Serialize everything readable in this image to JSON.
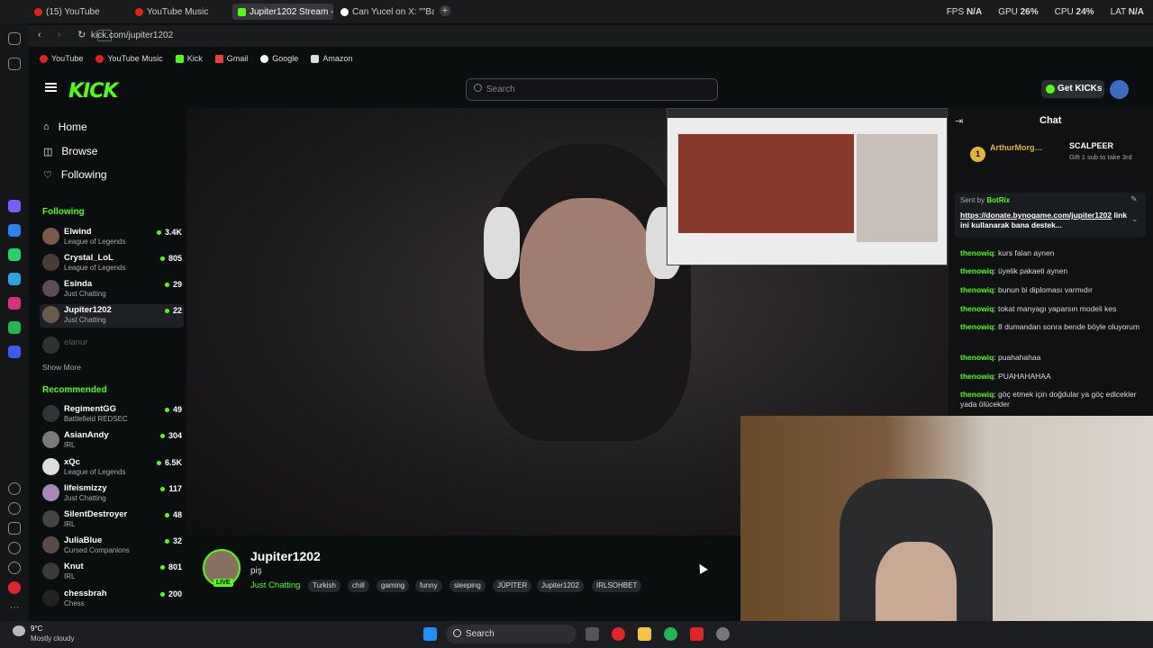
{
  "browser": {
    "tabs": [
      {
        "label": "(15) YouTube",
        "color": "#e62117"
      },
      {
        "label": "YouTube Music",
        "color": "#e62117"
      },
      {
        "label": "Jupiter1202 Stream - …",
        "color": "#53fc18"
      },
      {
        "label": "Can Yucel on X: \"\"Bana g…",
        "color": "#ffffff"
      }
    ],
    "hud": {
      "fps_label": "FPS",
      "fps": "N/A",
      "gpu_label": "GPU",
      "gpu": "26%",
      "cpu_label": "CPU",
      "cpu": "24%",
      "lat_label": "LAT",
      "lat": "N/A"
    },
    "url": "kick.com/jupiter1202",
    "bookmarks": [
      "YouTube",
      "YouTube Music",
      "Kick",
      "Gmail",
      "Google",
      "Amazon"
    ]
  },
  "header": {
    "logo": "KICK",
    "search_placeholder": "Search",
    "get_kicks": "Get KICKs"
  },
  "nav": {
    "home": "Home",
    "browse": "Browse",
    "following": "Following"
  },
  "following": {
    "title": "Following",
    "show_more": "Show More",
    "channels": [
      {
        "name": "Elwind",
        "category": "League of Legends",
        "viewers": "3.4K"
      },
      {
        "name": "Crystal_LoL",
        "category": "League of Legends",
        "viewers": "805"
      },
      {
        "name": "Esinda",
        "category": "Just Chatting",
        "viewers": "29"
      },
      {
        "name": "Jupiter1202",
        "category": "Just Chatting",
        "viewers": "22"
      },
      {
        "name": "elanur",
        "category": "",
        "viewers": ""
      }
    ]
  },
  "recommended": {
    "title": "Recommended",
    "channels": [
      {
        "name": "RegimentGG",
        "category": "Battlefield REDSEC",
        "viewers": "49"
      },
      {
        "name": "AsianAndy",
        "category": "IRL",
        "viewers": "304"
      },
      {
        "name": "xQc",
        "category": "League of Legends",
        "viewers": "6.5K"
      },
      {
        "name": "lifeismizzy",
        "category": "Just Chatting",
        "viewers": "117"
      },
      {
        "name": "SilentDestroyer",
        "category": "IRL",
        "viewers": "48"
      },
      {
        "name": "JuliaBlue",
        "category": "Cursed Companions",
        "viewers": "32"
      },
      {
        "name": "Knut",
        "category": "IRL",
        "viewers": "801"
      },
      {
        "name": "chessbrah",
        "category": "Chess",
        "viewers": "200"
      }
    ]
  },
  "chat": {
    "title": "Chat",
    "gifter_name": "ArthurMorg…",
    "gifter_badge": "1",
    "gift_user": "SCALPEER",
    "gift_text": "Gift 1 sub to take 3rd",
    "pinned_by_label": "Sent by",
    "pinned_by": "BotRix",
    "pinned_link": "https://donate.bynogame.com/jupiter1202",
    "pinned_text": "linkini kullanarak bana destek...",
    "messages": [
      {
        "user": "thenowiq",
        "text": "kurs falan aynen"
      },
      {
        "user": "thenowiq",
        "text": "üyelik pakaeti aynen"
      },
      {
        "user": "thenowiq",
        "text": "bunun bi diploması varmıdır"
      },
      {
        "user": "thenowiq",
        "text": "tokat manyagı yaparsın modeli kes"
      },
      {
        "user": "thenowiq",
        "text": "8 dumandan sonra bende böyle oluyorum"
      },
      {
        "user": "thenowiq",
        "text": "puahahahaa"
      },
      {
        "user": "thenowiq",
        "text": "PUAHAHAHAA"
      },
      {
        "user": "thenowiq",
        "text": "göç etmek için doğdular ya göç edicekler yada ölücekler"
      }
    ]
  },
  "stream": {
    "streamer": "Jupiter1202",
    "title": "piş",
    "live": "LIVE",
    "category": "Just Chatting",
    "tags": [
      "Turkish",
      "chill",
      "gaming",
      "funny",
      "sleeping",
      "JÜPİTER",
      "Jupiter1202",
      "IRLSOHBET"
    ]
  },
  "taskbar": {
    "weather_temp": "9°C",
    "weather_desc": "Mostly cloudy",
    "search": "Search"
  }
}
